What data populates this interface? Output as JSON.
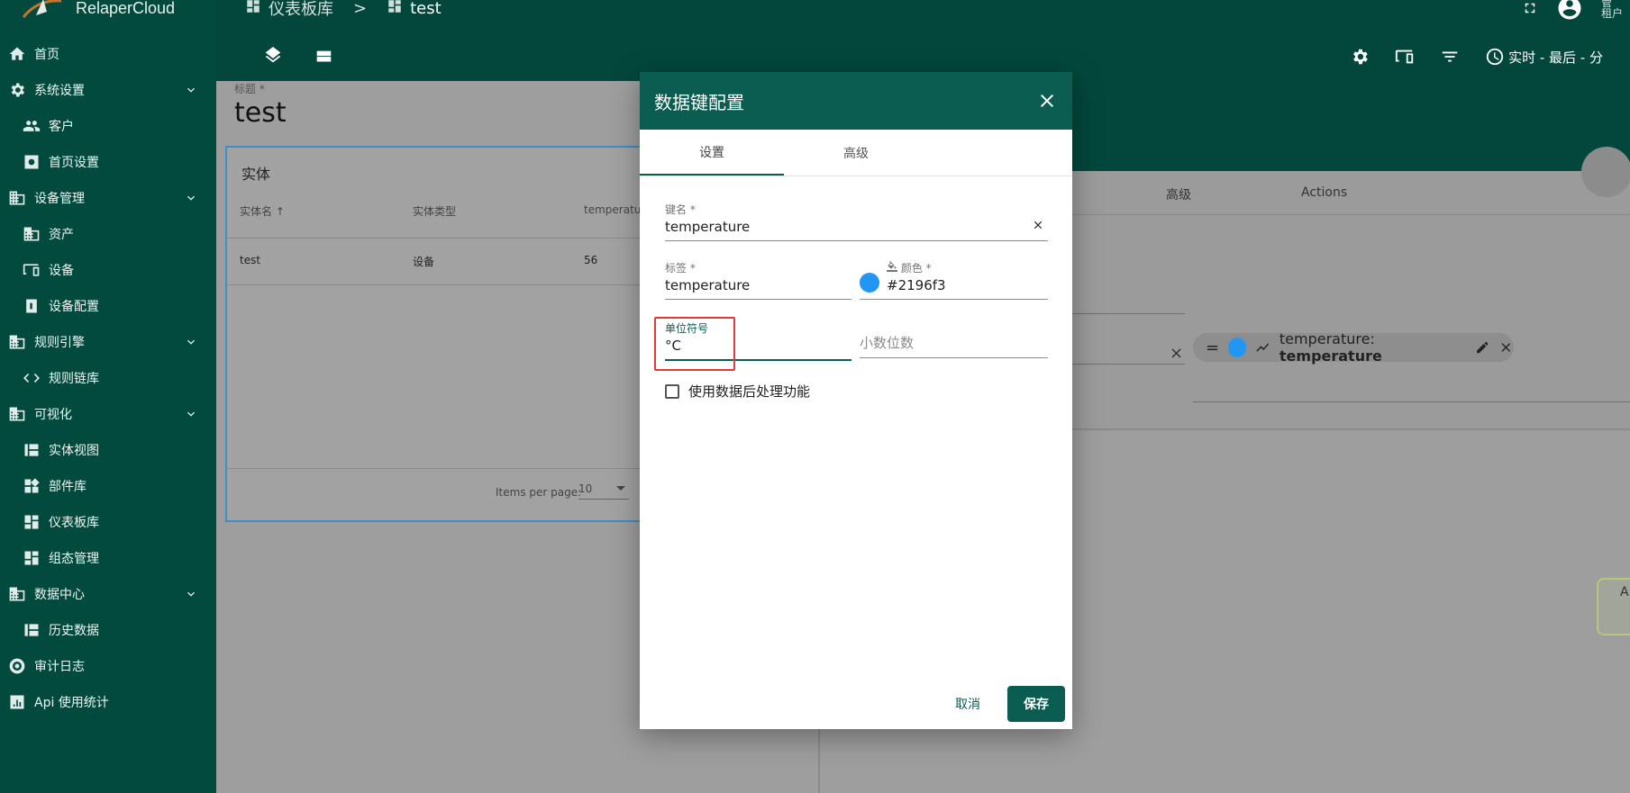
{
  "brand": {
    "name": "RelaperCloud"
  },
  "sidebar": {
    "items": [
      {
        "label": "首页",
        "icon": "home-icon",
        "level": 0
      },
      {
        "label": "系统设置",
        "icon": "gear-icon",
        "level": 0,
        "expandable": true
      },
      {
        "label": "客户",
        "icon": "people-icon",
        "level": 1
      },
      {
        "label": "首页设置",
        "icon": "settings-box-icon",
        "level": 1
      },
      {
        "label": "设备管理",
        "icon": "building-icon",
        "level": 0,
        "expandable": true
      },
      {
        "label": "资产",
        "icon": "building-icon",
        "level": 1
      },
      {
        "label": "设备",
        "icon": "devices-icon",
        "level": 1
      },
      {
        "label": "设备配置",
        "icon": "device-profile-icon",
        "level": 1
      },
      {
        "label": "规则引擎",
        "icon": "building-icon",
        "level": 0,
        "expandable": true
      },
      {
        "label": "规则链库",
        "icon": "code-icon",
        "level": 1
      },
      {
        "label": "可视化",
        "icon": "building-icon",
        "level": 0,
        "expandable": true
      },
      {
        "label": "实体视图",
        "icon": "view-icon",
        "level": 1
      },
      {
        "label": "部件库",
        "icon": "widgets-icon",
        "level": 1
      },
      {
        "label": "仪表板库",
        "icon": "dashboard-icon",
        "level": 1
      },
      {
        "label": "组态管理",
        "icon": "dashboard-icon",
        "level": 1
      },
      {
        "label": "数据中心",
        "icon": "building-icon",
        "level": 0,
        "expandable": true
      },
      {
        "label": "历史数据",
        "icon": "view-icon",
        "level": 1
      },
      {
        "label": "审计日志",
        "icon": "track-icon",
        "level": 0
      },
      {
        "label": "Api 使用统计",
        "icon": "chart-icon",
        "level": 0
      }
    ]
  },
  "topbar": {
    "breadcrumb": {
      "parent": "仪表板库",
      "separator": ">",
      "current": "test"
    },
    "time_label": "实时 - 最后 - 分",
    "user_line1": "管",
    "user_line2": "租户"
  },
  "dashboard": {
    "title_label": "标题 *",
    "title_value": "test",
    "entities_card": {
      "title": "实体",
      "columns": [
        "实体名 ↑",
        "实体类型",
        "temperature"
      ],
      "rows": [
        {
          "name": "test",
          "type": "设备",
          "value": "56"
        }
      ],
      "items_per_page_label": "Items per page:",
      "items_per_page_value": "10"
    }
  },
  "background_panel": {
    "headers": [
      "高级",
      "Actions"
    ],
    "chip_label": "temperature: ",
    "chip_bold": "temperature",
    "side_card_text": "A"
  },
  "dialog": {
    "title": "数据键配置",
    "tabs": [
      "设置",
      "高级"
    ],
    "active_tab": "设置",
    "fields": {
      "key_label": "键名 *",
      "key_value": "temperature",
      "label_label": "标签 *",
      "label_value": "temperature",
      "color_label": "颜色 *",
      "color_value": "#2196f3",
      "color_text": "#2196f3",
      "units_label": "单位符号",
      "units_value": "°C",
      "decimals_placeholder": "小数位数"
    },
    "postprocess_label": "使用数据后处理功能",
    "cancel_label": "取消",
    "save_label": "保存"
  },
  "colors": {
    "primary": "#0b5d52",
    "sidebar": "#034a3e",
    "series": "#2196f3",
    "highlight": "#e53935"
  }
}
